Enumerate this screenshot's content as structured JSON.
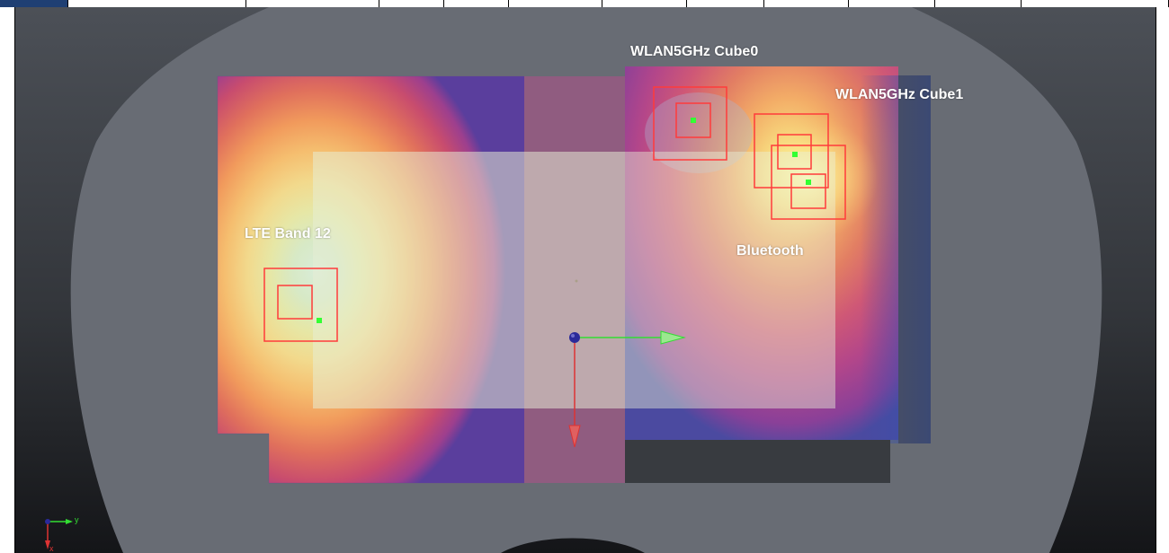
{
  "toolbar": {
    "tabs": [
      {
        "label": "",
        "active": true
      },
      {
        "label": "",
        "active": false
      },
      {
        "label": "",
        "active": false
      },
      {
        "label": "",
        "active": false
      },
      {
        "label": "",
        "active": false
      },
      {
        "label": "",
        "active": false
      },
      {
        "label": "",
        "active": false
      },
      {
        "label": "",
        "active": false
      },
      {
        "label": "",
        "active": false
      },
      {
        "label": "",
        "active": false
      },
      {
        "label": "",
        "active": false
      },
      {
        "label": "",
        "active": false
      }
    ]
  },
  "viewport": {
    "labels": {
      "wlan_cube0": "WLAN5GHz Cube0",
      "wlan_cube1": "WLAN5GHz Cube1",
      "lte_band12": "LTE Band 12",
      "bluetooth": "Bluetooth"
    },
    "axis_triad": {
      "y_label": "y",
      "x_label": "x"
    }
  },
  "colors": {
    "background_top": "#4a4e55",
    "background_bottom": "#15171a",
    "phantom": "#6b6f77",
    "marker_red": "#ff3b3b",
    "marker_green": "#33ff33",
    "axis_green": "#33dd33",
    "axis_red": "#dd3333",
    "origin_blue": "#2a2a9a",
    "header_active": "#1f3f73"
  }
}
